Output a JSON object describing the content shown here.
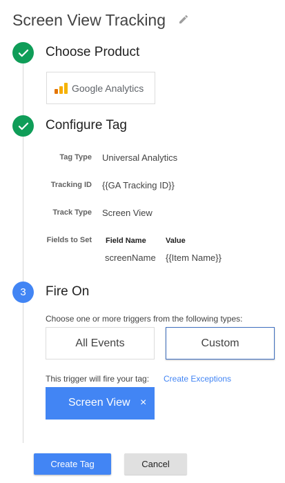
{
  "page": {
    "title": "Screen View Tracking"
  },
  "steps": [
    {
      "badge_icon": "check-icon",
      "title": "Choose Product"
    },
    {
      "badge_icon": "check-icon",
      "title": "Configure Tag"
    },
    {
      "badge_number": "3",
      "title": "Fire On"
    }
  ],
  "product": {
    "name": "Google Analytics",
    "logo_icon": "google-analytics-logo",
    "logo_colors": [
      "#f9ab00",
      "#f4b400",
      "#e37400"
    ]
  },
  "configure": {
    "tag_type_label": "Tag Type",
    "tag_type_value": "Universal Analytics",
    "tracking_id_label": "Tracking ID",
    "tracking_id_value": "{{GA Tracking ID}}",
    "track_type_label": "Track Type",
    "track_type_value": "Screen View",
    "fields_label": "Fields to Set",
    "fields_columns": [
      "Field Name",
      "Value"
    ],
    "fields_rows": [
      {
        "name": "screenName",
        "value": "{{Item Name}}"
      }
    ]
  },
  "fire_on": {
    "prompt": "Choose one or more triggers from the following types:",
    "options": [
      "All Events",
      "Custom"
    ],
    "selected_option": "Custom",
    "fire_text": "This trigger will fire your tag:",
    "exceptions_link": "Create Exceptions",
    "trigger_chip": "Screen View",
    "chip_close": "×"
  },
  "actions": {
    "create_label": "Create Tag",
    "cancel_label": "Cancel"
  },
  "colors": {
    "success": "#0f9d58",
    "accent": "#4285f4"
  }
}
